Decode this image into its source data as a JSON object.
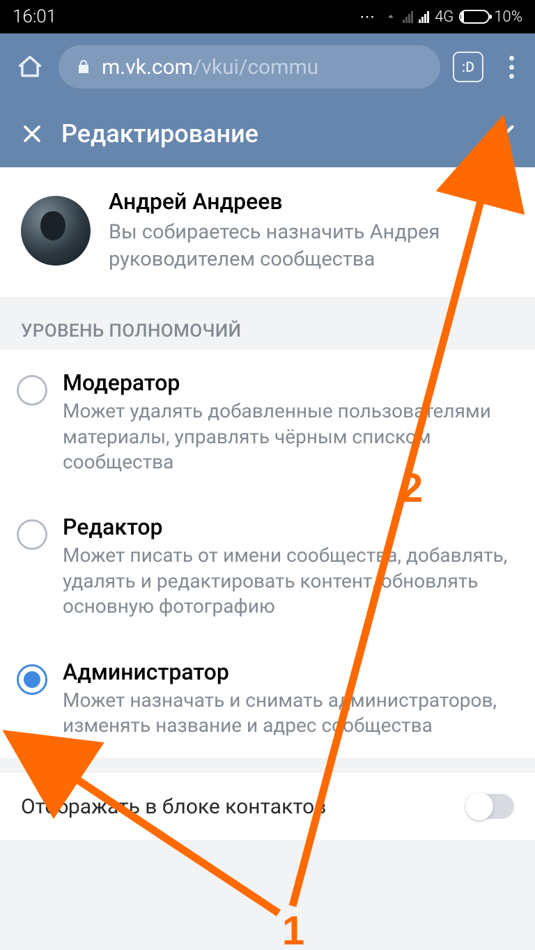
{
  "status": {
    "time": "16:01",
    "network_label": "4G",
    "battery_percent": "10%"
  },
  "chrome": {
    "url_domain": "m.vk.com",
    "url_path": "/vkui/commu",
    "tabs_face": ":D"
  },
  "header": {
    "title": "Редактирование"
  },
  "user": {
    "name": "Андрей Андреев",
    "description": "Вы собираетесь назначить Андрея руководителем сообщества"
  },
  "section_title": "УРОВЕНЬ ПОЛНОМОЧИЙ",
  "roles": [
    {
      "title": "Модератор",
      "desc": "Может удалять добавленные пользователями материалы, управлять чёрным списком сообщества",
      "selected": false
    },
    {
      "title": "Редактор",
      "desc": "Может писать от имени сообщества, добавлять, удалять и редактировать контент, обновлять основную фотографию",
      "selected": false
    },
    {
      "title": "Администратор",
      "desc": "Может назначать и снимать администраторов, изменять название и адрес сообщества",
      "selected": true
    }
  ],
  "toggle": {
    "label": "Отображать в блоке контактов",
    "on": false
  },
  "annotations": {
    "label1": "1",
    "label2": "2",
    "color": "#ff6a00"
  }
}
